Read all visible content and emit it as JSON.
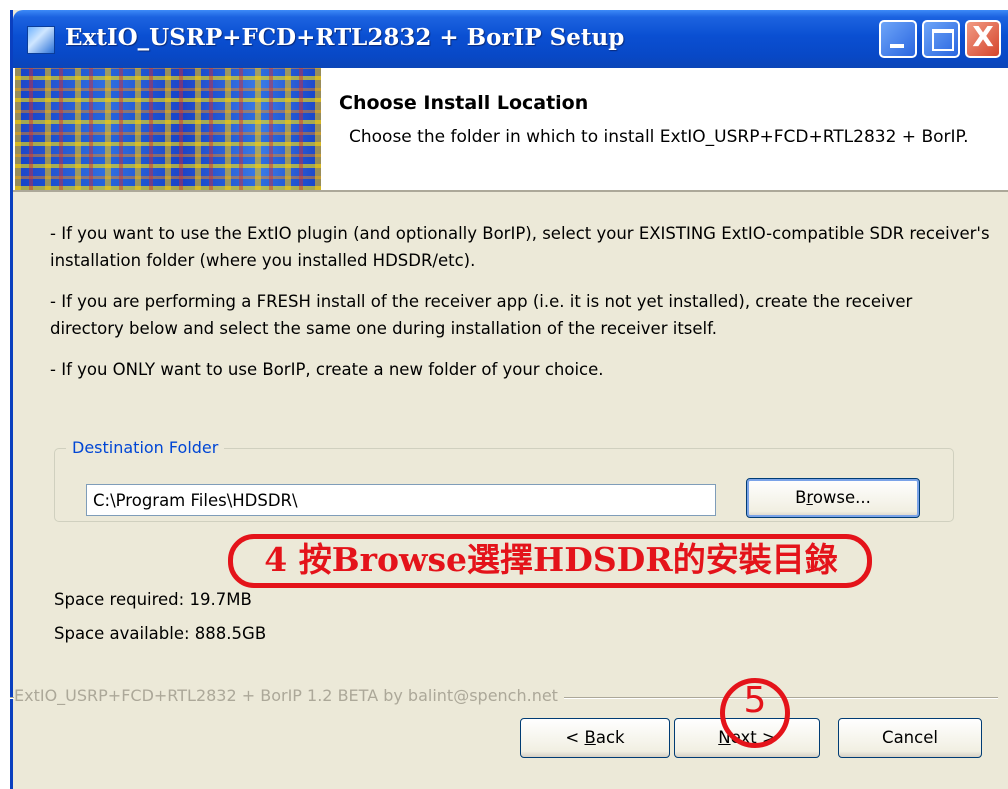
{
  "window": {
    "title": "ExtIO_USRP+FCD+RTL2832 + BorIP Setup",
    "controls": {
      "close": "X"
    }
  },
  "header": {
    "title": "Choose Install Location",
    "subtitle": "Choose the folder in which to install ExtIO_USRP+FCD+RTL2832 + BorIP."
  },
  "body": {
    "paragraphs": [
      "- If you want to use the ExtIO plugin (and optionally BorIP), select your EXISTING ExtIO-compatible SDR receiver's installation folder (where you installed HDSDR/etc).",
      "- If you are performing a FRESH install of the receiver app (i.e. it is not yet installed), create the receiver directory below and select the same one during installation of the receiver itself.",
      "- If you ONLY want to use BorIP, create a new folder of your choice."
    ]
  },
  "destination": {
    "group_label": "Destination Folder",
    "path": "C:\\Program Files\\HDSDR\\",
    "browse_pre": "B",
    "browse_key": "r",
    "browse_post": "owse..."
  },
  "annotation": {
    "step4_text": "4  按Browse選擇HDSDR的安裝目錄",
    "step5_text": "5"
  },
  "space": {
    "required": "Space required: 19.7MB",
    "available": "Space available: 888.5GB"
  },
  "footer": {
    "branding": "ExtIO_USRP+FCD+RTL2832 + BorIP 1.2 BETA by balint@spench.net",
    "back_pre": "< ",
    "back_key": "B",
    "back_post": "ack",
    "next_key": "N",
    "next_post": "ext >",
    "cancel_label": "Cancel"
  },
  "colors": {
    "titlebar": "#0a4fd2",
    "dialog_bg": "#ece9d8",
    "annotation": "#e4131a",
    "group_label": "#0046d5"
  }
}
